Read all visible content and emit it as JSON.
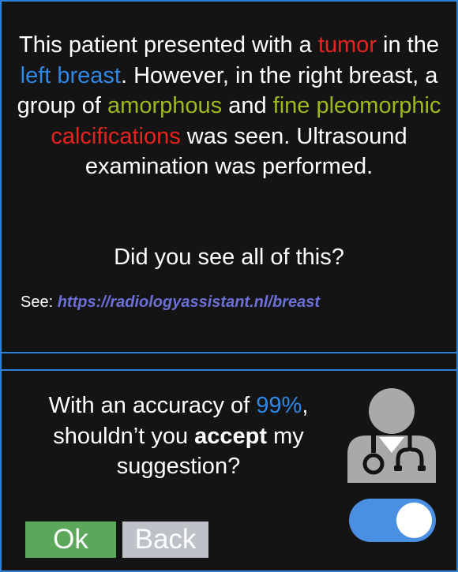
{
  "colors": {
    "border": "#2e82d6",
    "background": "#141414",
    "text": "#ffffff",
    "red_highlight": "#e8231f",
    "blue_highlight": "#2e88e8",
    "green_highlight": "#9fb81a",
    "link": "#6b6fd6",
    "ok_button": "#5ba85a",
    "back_button": "#bcc2c8",
    "toggle_on": "#4a90e2",
    "doctor_icon": "#a9a9a9"
  },
  "message": {
    "p1": "This patient presented with a ",
    "tumor": "tumor",
    "p2": " in the ",
    "left_breast": "left breast",
    "p3": ". However, in the right breast, a group of ",
    "amorphous": "amorphous",
    "p4": " and ",
    "fine_pleomorphic": "fine pleomorphic",
    "p5": " ",
    "calcifications": "calcifications",
    "p6": " was seen. Ultrasound examination was performed."
  },
  "question": "Did you see all of this?",
  "reference": {
    "label": "See: ",
    "link": "https://radiologyassistant.nl/breast"
  },
  "suggestion": {
    "p1": "With an accuracy of ",
    "accuracy": "99%",
    "p2": ", shouldn’t you ",
    "accept": "accept",
    "p3": " my suggestion?"
  },
  "icons": {
    "doctor": "doctor-icon"
  },
  "toggle": {
    "state": "on"
  },
  "buttons": {
    "ok": "Ok",
    "back": "Back"
  }
}
